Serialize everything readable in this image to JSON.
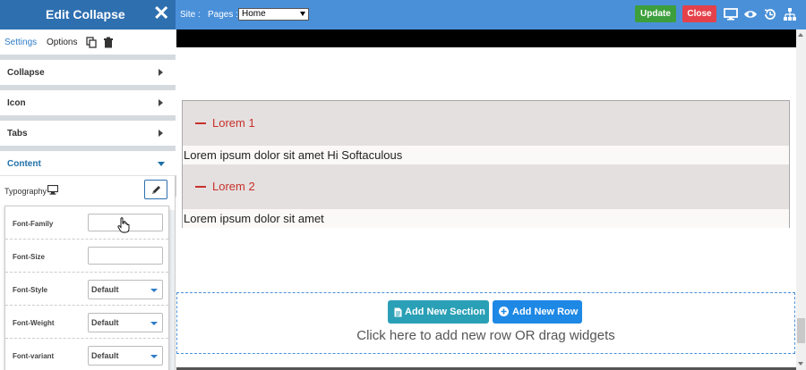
{
  "panel": {
    "title": "Edit Collapse",
    "tabs": {
      "settings": "Settings",
      "options": "Options"
    },
    "sections": [
      {
        "label": "Collapse"
      },
      {
        "label": "Icon"
      },
      {
        "label": "Tabs"
      },
      {
        "label": "Content"
      }
    ],
    "typography": {
      "label": "Typography",
      "fields": [
        {
          "label": "Font-Family",
          "value": ""
        },
        {
          "label": "Font-Size",
          "value": ""
        },
        {
          "label": "Font-Style",
          "value": "Default"
        },
        {
          "label": "Font-Weight",
          "value": "Default"
        },
        {
          "label": "Font-variant",
          "value": "Default"
        }
      ]
    }
  },
  "topbar": {
    "site_label": "Site :",
    "pages_label": "Pages :",
    "pages_value": "Home",
    "update_label": "Update",
    "close_label": "Close"
  },
  "collapse": {
    "items": [
      {
        "title": "Lorem 1",
        "body": "Lorem ipsum dolor sit amet Hi Softaculous"
      },
      {
        "title": "Lorem 2",
        "body": "Lorem ipsum dolor sit amet"
      }
    ]
  },
  "dropzone": {
    "add_section_label": "Add New Section",
    "add_row_label": "Add New Row",
    "hint": "Click here to add new row OR drag widgets"
  },
  "colors": {
    "topbar": "#4a90d9",
    "panel_header": "#2e6fb0",
    "update": "#3c9f3c",
    "close": "#e5414a",
    "accent_red": "#c7312c"
  }
}
